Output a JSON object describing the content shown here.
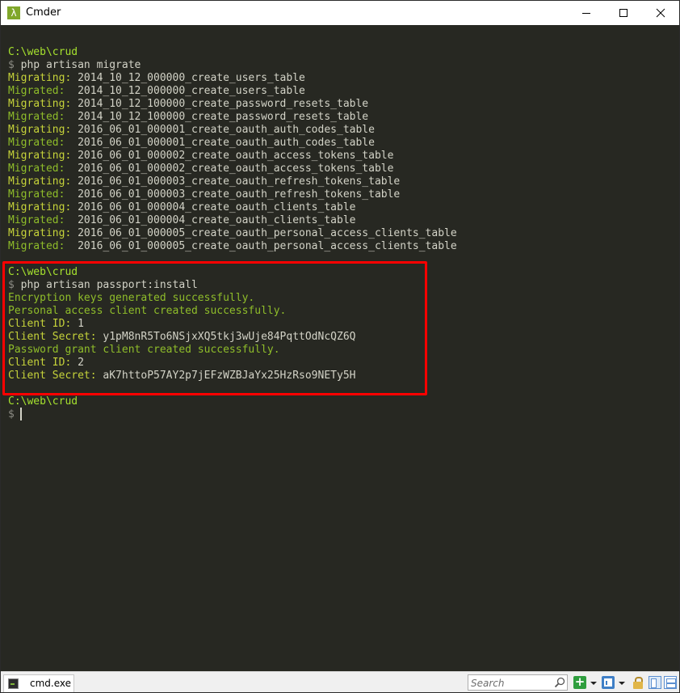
{
  "window": {
    "title": "Cmder",
    "app_icon_glyph": "λ"
  },
  "terminal": {
    "lines": [
      {
        "parts": []
      },
      {
        "parts": [
          {
            "t": "C:\\web\\crud",
            "c": "path"
          }
        ]
      },
      {
        "parts": [
          {
            "t": "$ ",
            "c": "prompt"
          },
          {
            "t": "php artisan migrate",
            "c": "cmd"
          }
        ]
      },
      {
        "parts": [
          {
            "t": "Migrating: ",
            "c": "migrating"
          },
          {
            "t": "2014_10_12_000000_create_users_table",
            "c": "text"
          }
        ]
      },
      {
        "parts": [
          {
            "t": "Migrated:  ",
            "c": "migrated"
          },
          {
            "t": "2014_10_12_000000_create_users_table",
            "c": "text"
          }
        ]
      },
      {
        "parts": [
          {
            "t": "Migrating: ",
            "c": "migrating"
          },
          {
            "t": "2014_10_12_100000_create_password_resets_table",
            "c": "text"
          }
        ]
      },
      {
        "parts": [
          {
            "t": "Migrated:  ",
            "c": "migrated"
          },
          {
            "t": "2014_10_12_100000_create_password_resets_table",
            "c": "text"
          }
        ]
      },
      {
        "parts": [
          {
            "t": "Migrating: ",
            "c": "migrating"
          },
          {
            "t": "2016_06_01_000001_create_oauth_auth_codes_table",
            "c": "text"
          }
        ]
      },
      {
        "parts": [
          {
            "t": "Migrated:  ",
            "c": "migrated"
          },
          {
            "t": "2016_06_01_000001_create_oauth_auth_codes_table",
            "c": "text"
          }
        ]
      },
      {
        "parts": [
          {
            "t": "Migrating: ",
            "c": "migrating"
          },
          {
            "t": "2016_06_01_000002_create_oauth_access_tokens_table",
            "c": "text"
          }
        ]
      },
      {
        "parts": [
          {
            "t": "Migrated:  ",
            "c": "migrated"
          },
          {
            "t": "2016_06_01_000002_create_oauth_access_tokens_table",
            "c": "text"
          }
        ]
      },
      {
        "parts": [
          {
            "t": "Migrating: ",
            "c": "migrating"
          },
          {
            "t": "2016_06_01_000003_create_oauth_refresh_tokens_table",
            "c": "text"
          }
        ]
      },
      {
        "parts": [
          {
            "t": "Migrated:  ",
            "c": "migrated"
          },
          {
            "t": "2016_06_01_000003_create_oauth_refresh_tokens_table",
            "c": "text"
          }
        ]
      },
      {
        "parts": [
          {
            "t": "Migrating: ",
            "c": "migrating"
          },
          {
            "t": "2016_06_01_000004_create_oauth_clients_table",
            "c": "text"
          }
        ]
      },
      {
        "parts": [
          {
            "t": "Migrated:  ",
            "c": "migrated"
          },
          {
            "t": "2016_06_01_000004_create_oauth_clients_table",
            "c": "text"
          }
        ]
      },
      {
        "parts": [
          {
            "t": "Migrating: ",
            "c": "migrating"
          },
          {
            "t": "2016_06_01_000005_create_oauth_personal_access_clients_table",
            "c": "text"
          }
        ]
      },
      {
        "parts": [
          {
            "t": "Migrated:  ",
            "c": "migrated"
          },
          {
            "t": "2016_06_01_000005_create_oauth_personal_access_clients_table",
            "c": "text"
          }
        ]
      },
      {
        "parts": []
      },
      {
        "parts": [
          {
            "t": "C:\\web\\crud",
            "c": "path"
          }
        ]
      },
      {
        "parts": [
          {
            "t": "$ ",
            "c": "prompt"
          },
          {
            "t": "php artisan passport:install",
            "c": "cmd"
          }
        ]
      },
      {
        "parts": [
          {
            "t": "Encryption keys generated successfully.",
            "c": "success"
          }
        ]
      },
      {
        "parts": [
          {
            "t": "Personal access client created successfully.",
            "c": "success"
          }
        ]
      },
      {
        "parts": [
          {
            "t": "Client ID: ",
            "c": "label"
          },
          {
            "t": "1",
            "c": "text"
          }
        ]
      },
      {
        "parts": [
          {
            "t": "Client Secret: ",
            "c": "label"
          },
          {
            "t": "y1pM8nR5To6NSjxXQ5tkj3wUje84PqttOdNcQZ6Q",
            "c": "text"
          }
        ]
      },
      {
        "parts": [
          {
            "t": "Password grant client created successfully.",
            "c": "success"
          }
        ]
      },
      {
        "parts": [
          {
            "t": "Client ID: ",
            "c": "label"
          },
          {
            "t": "2",
            "c": "text"
          }
        ]
      },
      {
        "parts": [
          {
            "t": "Client Secret: ",
            "c": "label"
          },
          {
            "t": "aK7httoP57AY2p7jEFzWZBJaYx25HzRso9NETy5H",
            "c": "text"
          }
        ]
      },
      {
        "parts": []
      },
      {
        "parts": [
          {
            "t": "C:\\web\\crud",
            "c": "path"
          }
        ]
      },
      {
        "parts": [
          {
            "t": "$ ",
            "c": "prompt"
          }
        ]
      }
    ]
  },
  "statusbar": {
    "tab_label": "cmd.exe",
    "search_placeholder": "Search"
  },
  "colors": {
    "terminal_bg": "#272822",
    "path": "#a6e22e",
    "highlight_border": "#ff0000"
  },
  "icons": [
    "lambda-app-icon",
    "minimize-icon",
    "maximize-icon",
    "close-icon",
    "cmd-tab-icon",
    "search-icon",
    "add-console-icon",
    "console-icon",
    "lock-icon",
    "split-left-icon",
    "split-bottom-icon"
  ]
}
